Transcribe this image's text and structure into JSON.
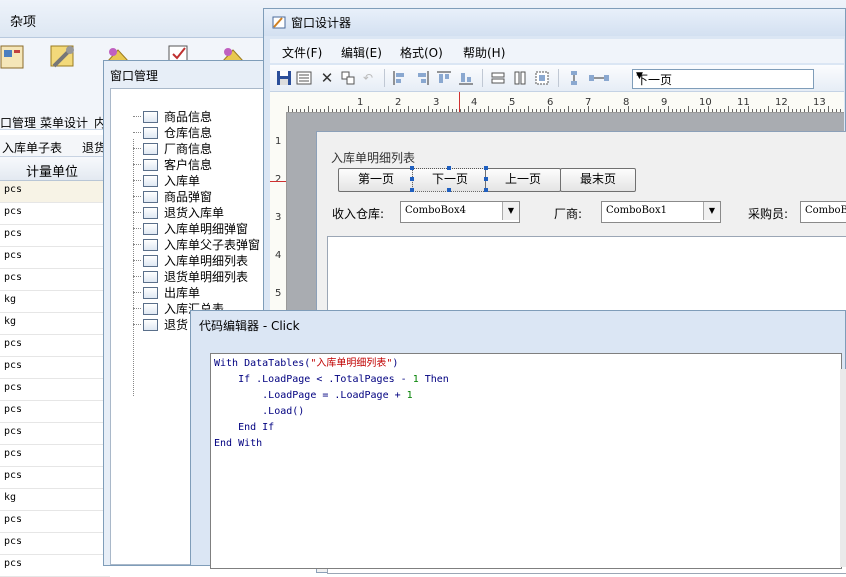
{
  "bg_app": {
    "title": "杂项",
    "ribbon": [
      "口管理",
      "菜单设计",
      "内"
    ],
    "tabs": [
      "入库单子表",
      "退货"
    ],
    "column_header": "计量单位",
    "units": [
      "pcs",
      "pcs",
      "pcs",
      "pcs",
      "pcs",
      "kg",
      "kg",
      "pcs",
      "pcs",
      "pcs",
      "pcs",
      "pcs",
      "pcs",
      "pcs",
      "kg",
      "pcs",
      "pcs",
      "pcs"
    ]
  },
  "window_manager": {
    "title": "窗口管理",
    "items": [
      "商品信息",
      "仓库信息",
      "厂商信息",
      "客户信息",
      "入库单",
      "商品弹窗",
      "退货入库单",
      "入库单明细弹窗",
      "入库单父子表弹窗",
      "入库单明细列表",
      "退货单明细列表",
      "出库单",
      "入库汇总表",
      "退货"
    ]
  },
  "designer": {
    "title": "窗口设计器",
    "menu": [
      "文件(F)",
      "编辑(E)",
      "格式(O)",
      "帮助(H)"
    ],
    "toolbar_combo": "下一页",
    "ruler_h": [
      "1",
      "2",
      "3",
      "4",
      "5",
      "6",
      "7",
      "8",
      "9",
      "10",
      "11",
      "12",
      "13"
    ],
    "ruler_v": [
      "1",
      "2",
      "3",
      "4",
      "5"
    ],
    "form": {
      "title": "入库单明细列表",
      "buttons": [
        "第一页",
        "下一页",
        "上一页",
        "最末页"
      ],
      "labels": [
        "收入仓库:",
        "厂商:",
        "采购员:"
      ],
      "combos": [
        "ComboBox4",
        "ComboBox1",
        "ComboBo"
      ]
    }
  },
  "code_editor": {
    "title": "代码编辑器 - Click",
    "lines": [
      [
        {
          "t": "With DataTables(",
          "c": "kw"
        },
        {
          "t": "\"入库单明细列表\"",
          "c": "str"
        },
        {
          "t": ")",
          "c": "kw"
        }
      ],
      [
        {
          "t": "    If .LoadPage < .TotalPages - ",
          "c": "kw"
        },
        {
          "t": "1",
          "c": "num"
        },
        {
          "t": " Then",
          "c": "kw"
        }
      ],
      [
        {
          "t": "        .LoadPage = .LoadPage + ",
          "c": "kw"
        },
        {
          "t": "1",
          "c": "num"
        }
      ],
      [
        {
          "t": "        .Load()",
          "c": "kw"
        }
      ],
      [
        {
          "t": "    End If",
          "c": "kw"
        }
      ],
      [
        {
          "t": "End With",
          "c": "kw"
        }
      ]
    ]
  }
}
